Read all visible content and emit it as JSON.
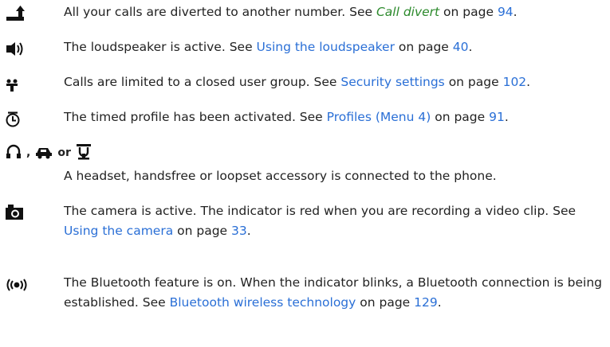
{
  "entries": [
    {
      "icon": "call-divert-icon",
      "text_before": "All your calls are diverted to another number. See ",
      "link": "Call divert",
      "text_mid": " on page ",
      "page": "94",
      "text_after": "."
    },
    {
      "icon": "loudspeaker-icon",
      "text_before": "The loudspeaker is active. See ",
      "link": "Using the loudspeaker",
      "text_mid": " on page ",
      "page": "40",
      "text_after": "."
    },
    {
      "icon": "closed-user-group-icon",
      "text_before": "Calls are limited to a closed user group. See ",
      "link": "Security settings",
      "text_mid": " on page ",
      "page": "102",
      "text_after": "."
    },
    {
      "icon": "timed-profile-icon",
      "text_before": "The timed profile has been activated. See ",
      "link": "Profiles (Menu 4)",
      "text_mid": " on page ",
      "page": "91",
      "text_after": "."
    }
  ],
  "accessory": {
    "sep1": ",",
    "sep2": "or",
    "text": "A headset, handsfree or loopset accessory is connected to the phone."
  },
  "camera": {
    "text_before": "The camera is active. The indicator is red when you are recording a video clip. See ",
    "link": "Using the camera",
    "text_mid": " on page ",
    "page": "33",
    "text_after": "."
  },
  "bluetooth": {
    "text_before": "The Bluetooth feature is on. When the indicator blinks, a Bluetooth connection is being established. See ",
    "link": "Bluetooth wireless technology",
    "text_mid": " on ",
    "page_word": "page ",
    "page": "129",
    "text_after": "."
  },
  "colors": {
    "link": "#2a6fd6",
    "link_italic": "#2c8a2c",
    "text": "#222222"
  }
}
